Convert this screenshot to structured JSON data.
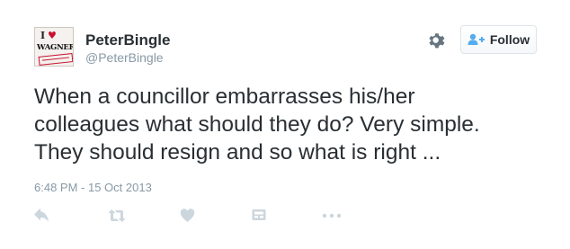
{
  "author": {
    "name": "PeterBingle",
    "handle": "@PeterBingle",
    "avatar": {
      "icon": "i-love-wagner-logo",
      "line1": "I",
      "line2": "WAGNER"
    }
  },
  "header": {
    "settings_icon": "gear-icon",
    "follow_label": "Follow",
    "follow_icon": "follow-user-plus-icon"
  },
  "tweet": {
    "lines": [
      "When a councillor embarrasses his/her",
      "colleagues what should they do? Very simple.",
      "They should resign and so what is right ..."
    ],
    "timestamp": "6:48 PM - 15 Oct 2013"
  },
  "actions": {
    "icons": [
      "reply-icon",
      "retweet-icon",
      "like-heart-icon",
      "card-icon",
      "more-icon"
    ]
  },
  "colors": {
    "text": "#292f33",
    "muted": "#8899a6",
    "icon": "#ccd6dd",
    "accent": "#55acee",
    "gear": "#66757f"
  }
}
